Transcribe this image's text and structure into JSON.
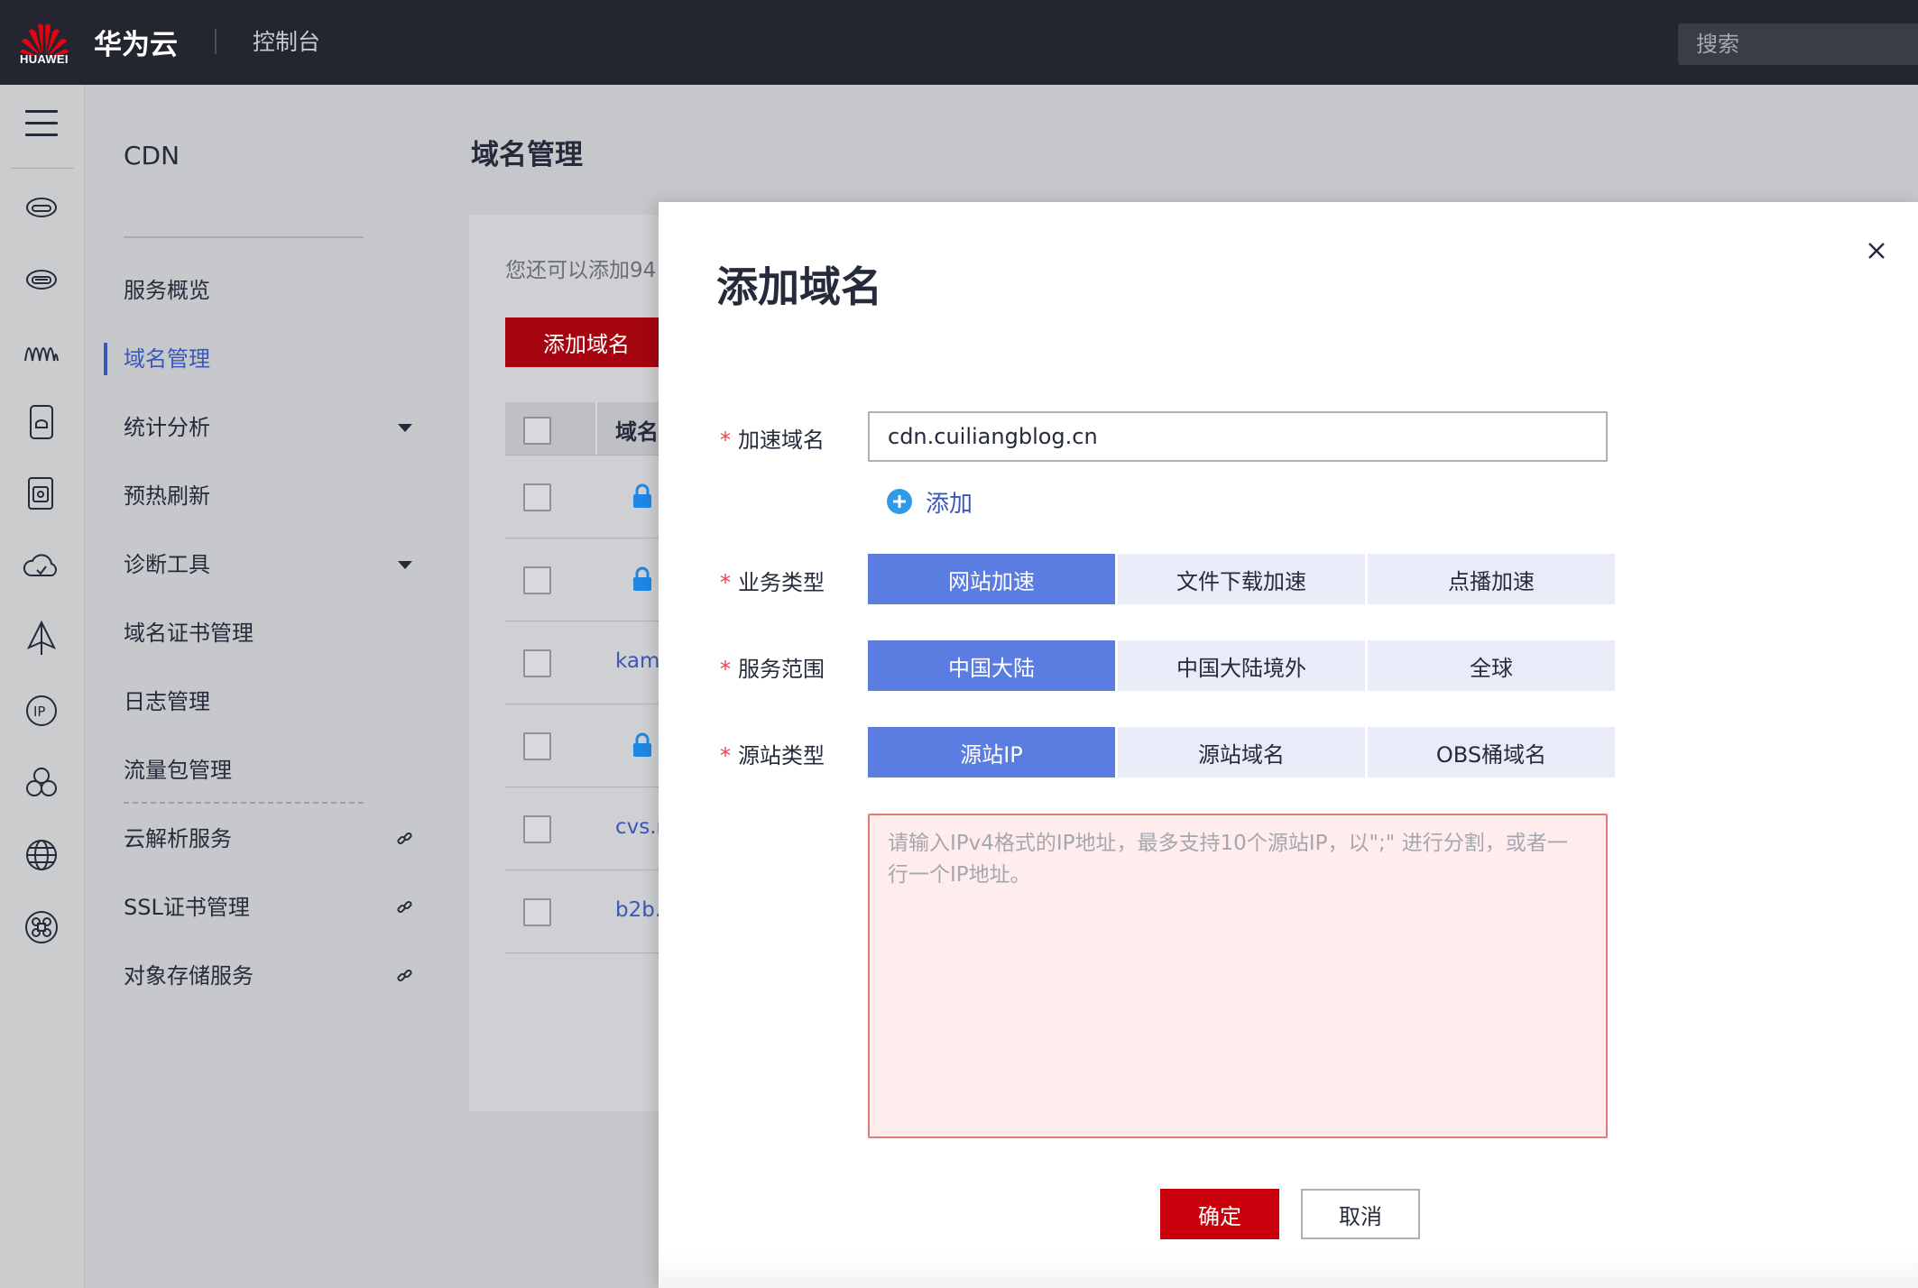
{
  "header": {
    "logo_text": "HUAWEI",
    "brand": "华为云",
    "console": "控制台",
    "search_placeholder": "搜索"
  },
  "sidebar": {
    "title": "CDN",
    "items": [
      {
        "label": "服务概览"
      },
      {
        "label": "域名管理",
        "active": true
      },
      {
        "label": "统计分析"
      },
      {
        "label": "预热刷新"
      },
      {
        "label": "诊断工具"
      },
      {
        "label": "域名证书管理"
      },
      {
        "label": "日志管理"
      },
      {
        "label": "流量包管理"
      },
      {
        "label": "云解析服务"
      },
      {
        "label": "SSL证书管理"
      },
      {
        "label": "对象存储服务"
      }
    ]
  },
  "main": {
    "page_title": "域名管理",
    "quota_text": "您还可以添加94",
    "add_button": "添加域名",
    "table_header": "域名",
    "rows": [
      "",
      "",
      "kami",
      "",
      "cvs.r",
      "b2b."
    ]
  },
  "modal": {
    "title": "添加域名",
    "domain_label": "加速域名",
    "domain_value": "cdn.cuiliangblog.cn",
    "add_more": "添加",
    "business_label": "业务类型",
    "business_options": [
      "网站加速",
      "文件下载加速",
      "点播加速"
    ],
    "scope_label": "服务范围",
    "scope_options": [
      "中国大陆",
      "中国大陆境外",
      "全球"
    ],
    "origin_label": "源站类型",
    "origin_options": [
      "源站IP",
      "源站域名",
      "OBS桶域名"
    ],
    "ip_placeholder": "请输入IPv4格式的IP地址，最多支持10个源站IP，以\";\" 进行分割，或者一行一个IP地址。",
    "ok": "确定",
    "cancel": "取消",
    "required_mark": "*"
  },
  "colors": {
    "topbar": "#23262e",
    "accent_blue": "#5b7de2",
    "link_blue": "#3b57b8",
    "primary_red": "#c7000b"
  }
}
